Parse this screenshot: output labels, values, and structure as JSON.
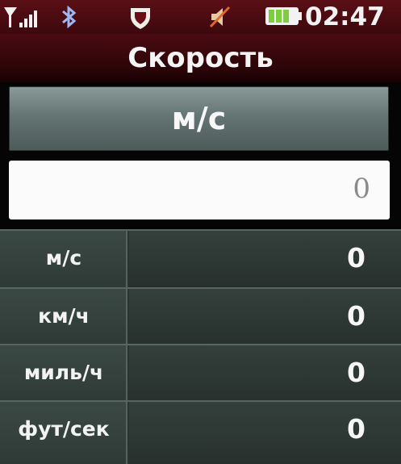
{
  "status_bar": {
    "time": "02:47",
    "icons": [
      "signal-icon",
      "bluetooth-icon",
      "shield-icon",
      "mute-icon",
      "battery-icon"
    ],
    "colors": {
      "bar": "#4a0b12",
      "battery_fill": "#7ccf3b"
    }
  },
  "header": {
    "title": "Скорость"
  },
  "unit_selector": {
    "label": "м/с"
  },
  "input": {
    "value": "0"
  },
  "results": [
    {
      "unit": "м/с",
      "value": "0"
    },
    {
      "unit": "км/ч",
      "value": "0"
    },
    {
      "unit": "миль/ч",
      "value": "0"
    },
    {
      "unit": "фут/сек",
      "value": "0"
    }
  ]
}
